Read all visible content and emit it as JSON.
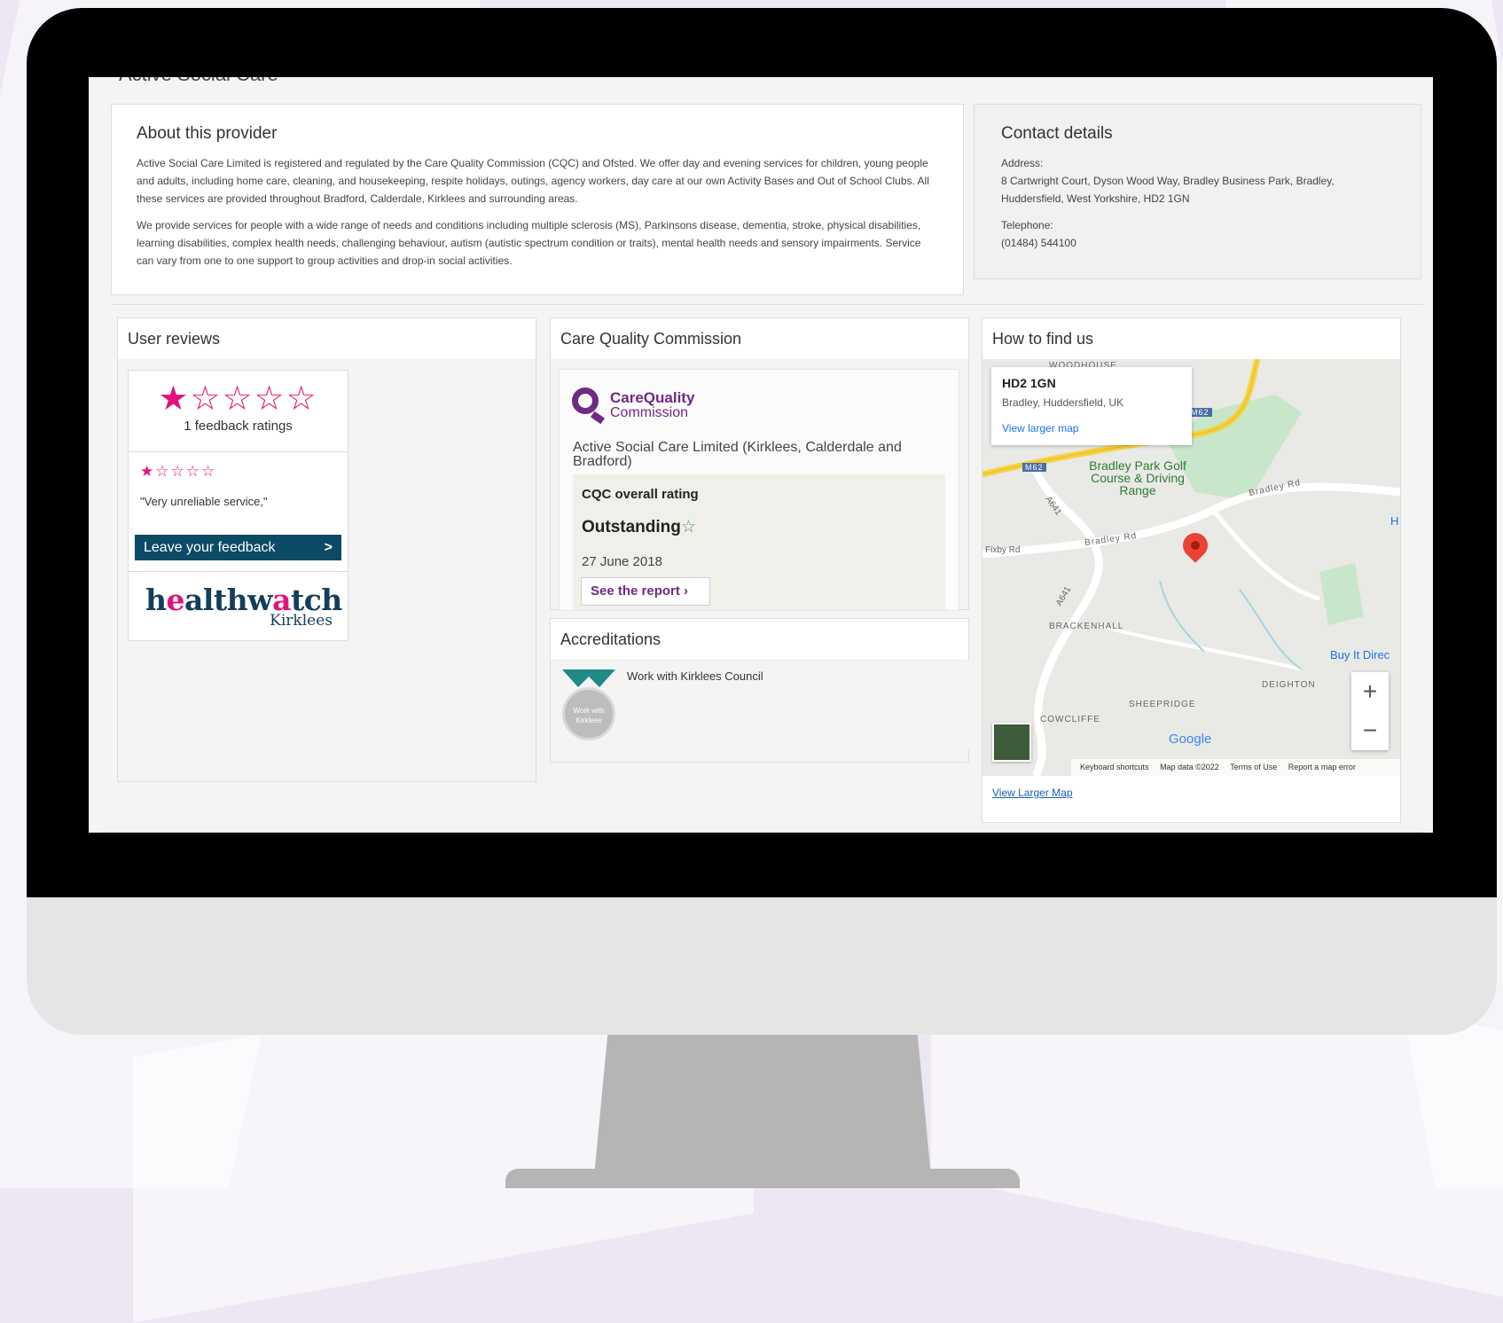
{
  "page": {
    "title": "Active Social Care"
  },
  "about": {
    "heading": "About this provider",
    "paragraph1": "Active Social Care Limited is registered and regulated by the Care Quality Commission (CQC) and Ofsted. We offer day and evening services for children, young people and adults, including home care, cleaning, and housekeeping, respite holidays, outings, agency workers, day care at our own Activity Bases and Out of School Clubs. All these services are provided throughout Bradford, Calderdale, Kirklees and surrounding areas.",
    "paragraph2": "We provide services for people with a wide range of needs and conditions including multiple sclerosis (MS), Parkinsons disease, dementia, stroke, physical disabilities, learning disabilities, complex health needs, challenging behaviour, autism (autistic spectrum condition or traits), mental health needs and sensory impairments. Service can vary from one to one support to group activities and drop-in social activities."
  },
  "contact": {
    "heading": "Contact details",
    "address_label": "Address:",
    "address": "8 Cartwright Court, Dyson Wood Way, Bradley Business Park, Bradley, Huddersfield, West Yorkshire, HD2 1GN",
    "telephone_label": "Telephone:",
    "telephone": "(01484) 544100"
  },
  "reviews": {
    "heading": "User reviews",
    "big_stars": "★☆☆☆☆",
    "rating_count": "1 feedback ratings",
    "review_stars": "★☆☆☆☆",
    "review_quote": "\"Very unreliable service,\"",
    "feedback_button": "Leave your feedback",
    "feedback_arrow": ">",
    "logo_main_a": "h",
    "logo_main_pink": "e",
    "logo_main_b": "althw",
    "logo_main_pink2": "a",
    "logo_main_c": "tch",
    "logo_sub": "Kirklees",
    "stars_value": 1,
    "stars_max": 5
  },
  "cqc": {
    "heading": "Care Quality Commission",
    "logo_line1": "CareQuality",
    "logo_line2": "Commission",
    "provider_name": "Active Social Care Limited (Kirklees, Calderdale and Bradford)",
    "rating_label": "CQC overall rating",
    "rating_value": "Outstanding",
    "rating_star": "☆",
    "date": "27 June 2018",
    "report_button": "See the report",
    "report_arrow": "›"
  },
  "accreditations": {
    "heading": "Accreditations",
    "badge_text": "Work with Kirklees",
    "item": "Work with Kirklees Council"
  },
  "findus": {
    "heading": "How to find us",
    "postcode": "HD2 1GN",
    "location": "Bradley, Huddersfield, UK",
    "view_larger_map_link": "View larger map",
    "map_labels": {
      "woodhouse": "WOODHOUSE",
      "golf": "Bradley Park Golf Course & Driving Range",
      "bradley_rd1": "Bradley Rd",
      "bradley_rd2": "Bradley Rd",
      "fixby": "Fixby Rd",
      "a641a": "A641",
      "a641b": "A641",
      "m62a": "M62",
      "m62b": "M62",
      "brackenhall": "BRACKENHALL",
      "deighton": "DEIGHTON",
      "sheepridge": "SHEEPRIDGE",
      "cowcliffe": "COWCLIFFE",
      "buy": "Buy It Direc",
      "h": "H"
    },
    "zoom_in": "+",
    "zoom_out": "−",
    "google": "Google",
    "footer": {
      "shortcuts": "Keyboard shortcuts",
      "data": "Map data ©2022",
      "terms": "Terms of Use",
      "report": "Report a map error"
    },
    "view_larger_map_footer": "View Larger Map"
  },
  "colors": {
    "accent_pink": "#e2127a",
    "navy": "#0c4a66",
    "cqc_purple": "#6f2a83",
    "outstanding_green": "#43a047"
  }
}
